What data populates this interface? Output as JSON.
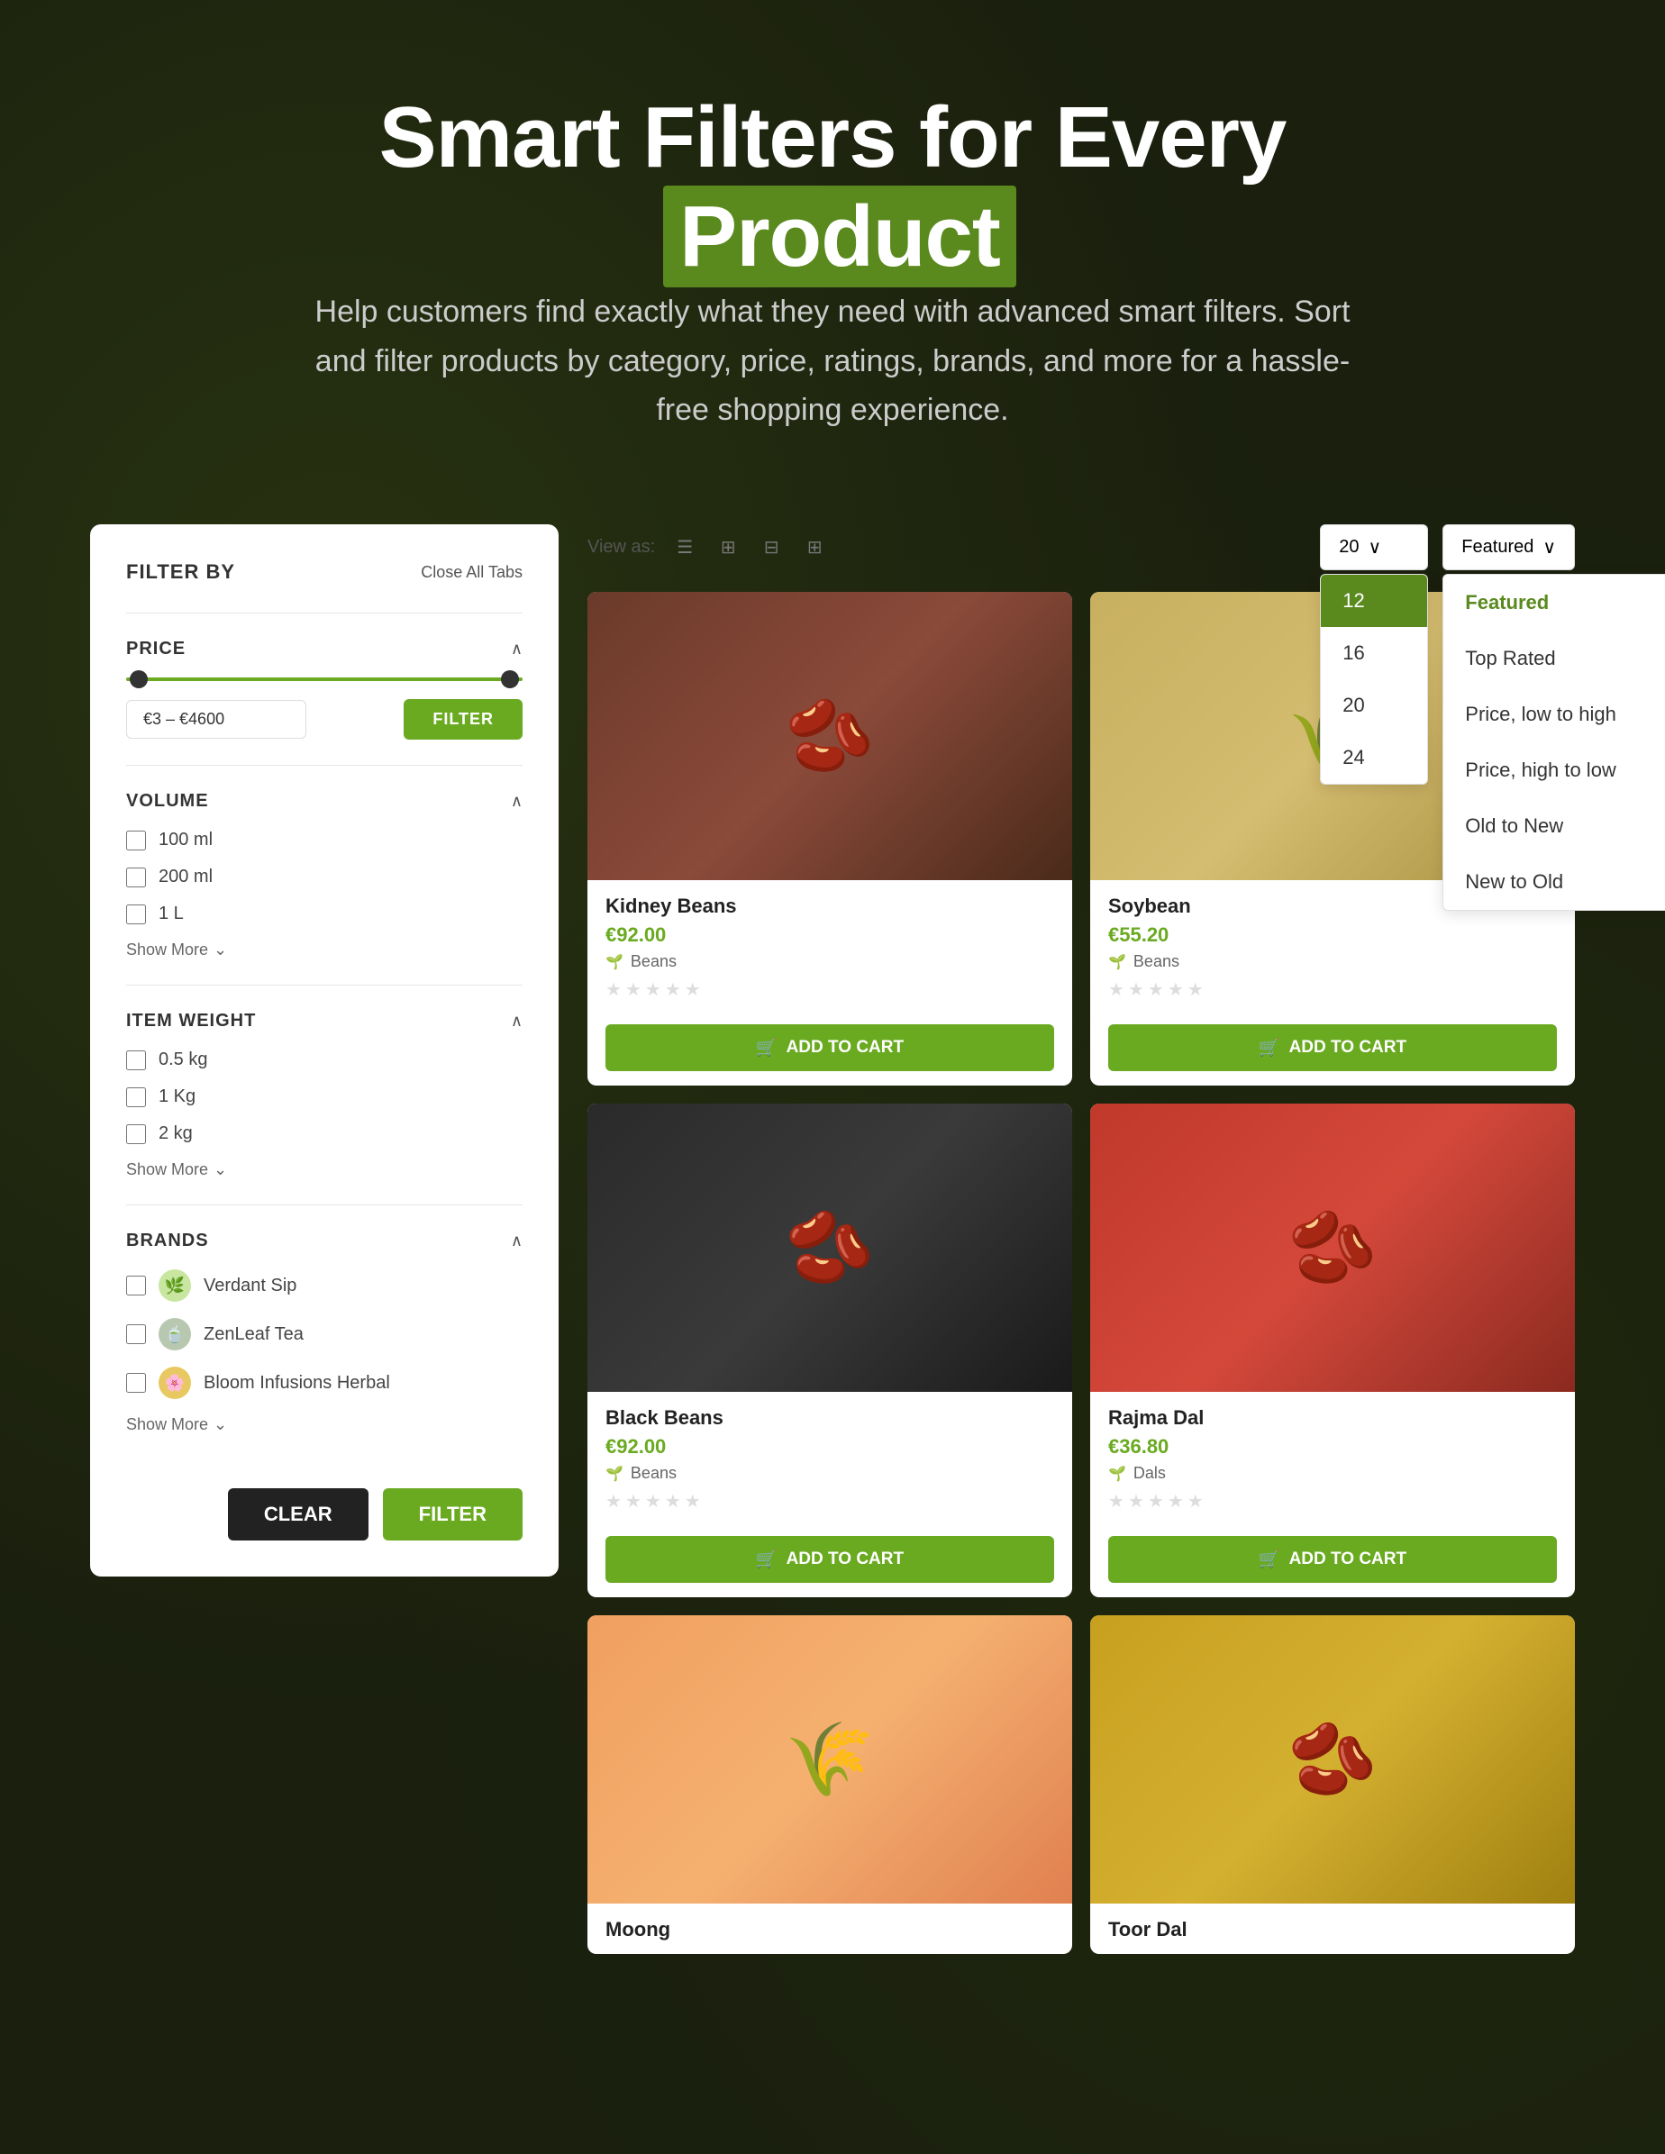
{
  "header": {
    "title_part1": "Smart Filters for Every",
    "title_accent": "Product",
    "subtitle": "Help customers find exactly what they need with advanced smart filters. Sort and filter products by category, price, ratings, brands, and more for a hassle-free shopping experience."
  },
  "filter_panel": {
    "title": "FILTER BY",
    "close_all": "Close All Tabs",
    "price_section": {
      "label": "PRICE",
      "range": "€3 – €4600",
      "filter_btn": "FILTER"
    },
    "volume_section": {
      "label": "VOLUME",
      "options": [
        "100 ml",
        "200 ml",
        "1 L"
      ],
      "show_more": "Show More"
    },
    "weight_section": {
      "label": "ITEM WEIGHT",
      "options": [
        "0.5 kg",
        "1 Kg",
        "2 kg"
      ],
      "show_more": "Show More"
    },
    "brands_section": {
      "label": "BRANDS",
      "options": [
        "Verdant Sip",
        "ZenLeaf Tea",
        "Bloom Infusions Herbal"
      ],
      "show_more": "Show More"
    },
    "clear_btn": "CLEAR",
    "filter_btn": "FILTER"
  },
  "toolbar": {
    "view_as_label": "View as:",
    "per_page": {
      "selected": "20",
      "options": [
        "12",
        "16",
        "20",
        "24"
      ]
    },
    "sort": {
      "selected": "Featured",
      "options": [
        "Featured",
        "Top Rated",
        "Price, low to high",
        "Price, high to low",
        "Old to New",
        "New to Old"
      ]
    }
  },
  "products": [
    {
      "name": "Kidney Beans",
      "price": "€92.00",
      "category": "Beans",
      "img_type": "kidney"
    },
    {
      "name": "Soybean",
      "price": "€55.20",
      "category": "Beans",
      "img_type": "soybean"
    },
    {
      "name": "Black Beans",
      "price": "€92.00",
      "category": "Beans",
      "img_type": "black-beans"
    },
    {
      "name": "Rajma Dal",
      "price": "€36.80",
      "category": "Dals",
      "img_type": "rajma"
    },
    {
      "name": "Moong",
      "price": "",
      "category": "",
      "img_type": "moong"
    },
    {
      "name": "Toor Dal",
      "price": "",
      "category": "",
      "img_type": "toor"
    }
  ],
  "add_to_cart_label": "ADD TO CART",
  "cart_icon": "🛒"
}
